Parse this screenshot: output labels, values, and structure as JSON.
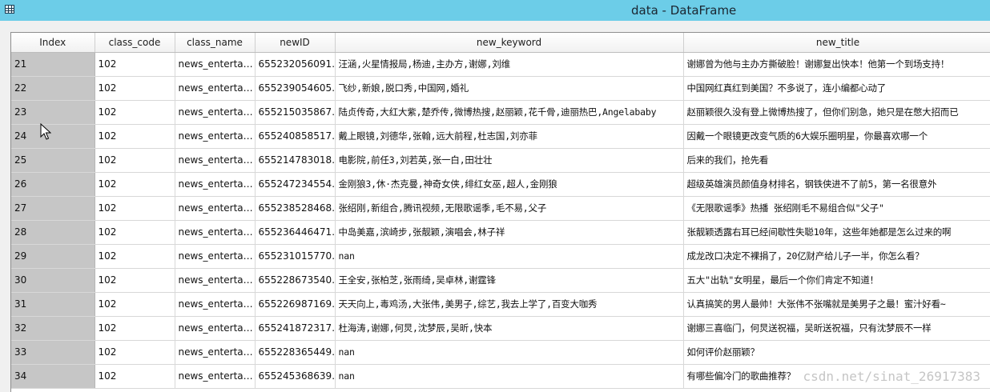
{
  "window": {
    "title": "data - DataFrame",
    "icon": "grid-icon"
  },
  "table": {
    "columns": [
      "Index",
      "class_code",
      "class_name",
      "newID",
      "new_keyword",
      "new_title"
    ],
    "rows": [
      {
        "index": "21",
        "class_code": "102",
        "class_name": "news_enterta…",
        "newID": "655232056091…",
        "new_keyword": "汪涵,火星情报局,杨迪,主办方,谢娜,刘维",
        "new_title": "谢娜曾为他与主办方撕破脸！谢娜复出快本！他第一个到场支持！"
      },
      {
        "index": "22",
        "class_code": "102",
        "class_name": "news_enterta…",
        "newID": "655239054605…",
        "new_keyword": "飞纱,新娘,脱口秀,中国网,婚礼",
        "new_title": "中国网红真红到美国？不多说了，连小编都心动了"
      },
      {
        "index": "23",
        "class_code": "102",
        "class_name": "news_enterta…",
        "newID": "655215035867…",
        "new_keyword": "陆贞传奇,大红大紫,楚乔传,微博热搜,赵丽颖,花千骨,迪丽热巴,Angelababy",
        "new_title": "赵丽颖很久没有登上微博热搜了，但你们别急，她只是在憋大招而已"
      },
      {
        "index": "24",
        "class_code": "102",
        "class_name": "news_enterta…",
        "newID": "655240858517…",
        "new_keyword": "戴上眼镜,刘德华,张翰,远大前程,杜志国,刘亦菲",
        "new_title": "因戴一个眼镜更改变气质的6大娱乐圈明星，你最喜欢哪一个"
      },
      {
        "index": "25",
        "class_code": "102",
        "class_name": "news_enterta…",
        "newID": "655214783018…",
        "new_keyword": "电影院,前任3,刘若英,张一白,田壮壮",
        "new_title": "后来的我们，抢先看"
      },
      {
        "index": "26",
        "class_code": "102",
        "class_name": "news_enterta…",
        "newID": "655247234554…",
        "new_keyword": "金刚狼3,休·杰克曼,神奇女侠,绯红女巫,超人,金刚狼",
        "new_title": "超级英雄演员颜值身材排名，钢铁侠进不了前5，第一名很意外"
      },
      {
        "index": "27",
        "class_code": "102",
        "class_name": "news_enterta…",
        "newID": "655238528468…",
        "new_keyword": "张绍刚,新组合,腾讯视频,无限歌谣季,毛不易,父子",
        "new_title": "《无限歌谣季》热播 张绍刚毛不易组合似\"父子\""
      },
      {
        "index": "28",
        "class_code": "102",
        "class_name": "news_enterta…",
        "newID": "655236446471…",
        "new_keyword": "中岛美嘉,滨崎步,张靓颖,演唱会,林子祥",
        "new_title": "张靓颖透露右耳已经间歇性失聪10年，这些年她都是怎么过来的啊"
      },
      {
        "index": "29",
        "class_code": "102",
        "class_name": "news_enterta…",
        "newID": "655231015770…",
        "new_keyword": "nan",
        "new_title": "成龙改口决定不裸捐了，20亿财产给儿子一半，你怎么看？"
      },
      {
        "index": "30",
        "class_code": "102",
        "class_name": "news_enterta…",
        "newID": "655228673540…",
        "new_keyword": "王全安,张柏芝,张雨绮,吴卓林,谢霆锋",
        "new_title": "五大\"出轨\"女明星，最后一个你们肯定不知道！"
      },
      {
        "index": "31",
        "class_code": "102",
        "class_name": "news_enterta…",
        "newID": "655226987169…",
        "new_keyword": "天天向上,毒鸡汤,大张伟,美男子,综艺,我去上学了,百变大咖秀",
        "new_title": "认真搞笑的男人最帅！大张伟不张嘴就是美男子之最！蜜汁好看~"
      },
      {
        "index": "32",
        "class_code": "102",
        "class_name": "news_enterta…",
        "newID": "655241872317…",
        "new_keyword": "杜海涛,谢娜,何炅,沈梦辰,吴昕,快本",
        "new_title": "谢娜三喜临门，何炅送祝福，吴昕送祝福，只有沈梦辰不一样"
      },
      {
        "index": "33",
        "class_code": "102",
        "class_name": "news_enterta…",
        "newID": "655228365449…",
        "new_keyword": "nan",
        "new_title": "如何评价赵丽颖？"
      },
      {
        "index": "34",
        "class_code": "102",
        "class_name": "news_enterta…",
        "newID": "655245368639…",
        "new_keyword": "nan",
        "new_title": "有哪些偏冷门的歌曲推荐？"
      }
    ]
  },
  "watermark": "csdn.net/sinat_26917383"
}
